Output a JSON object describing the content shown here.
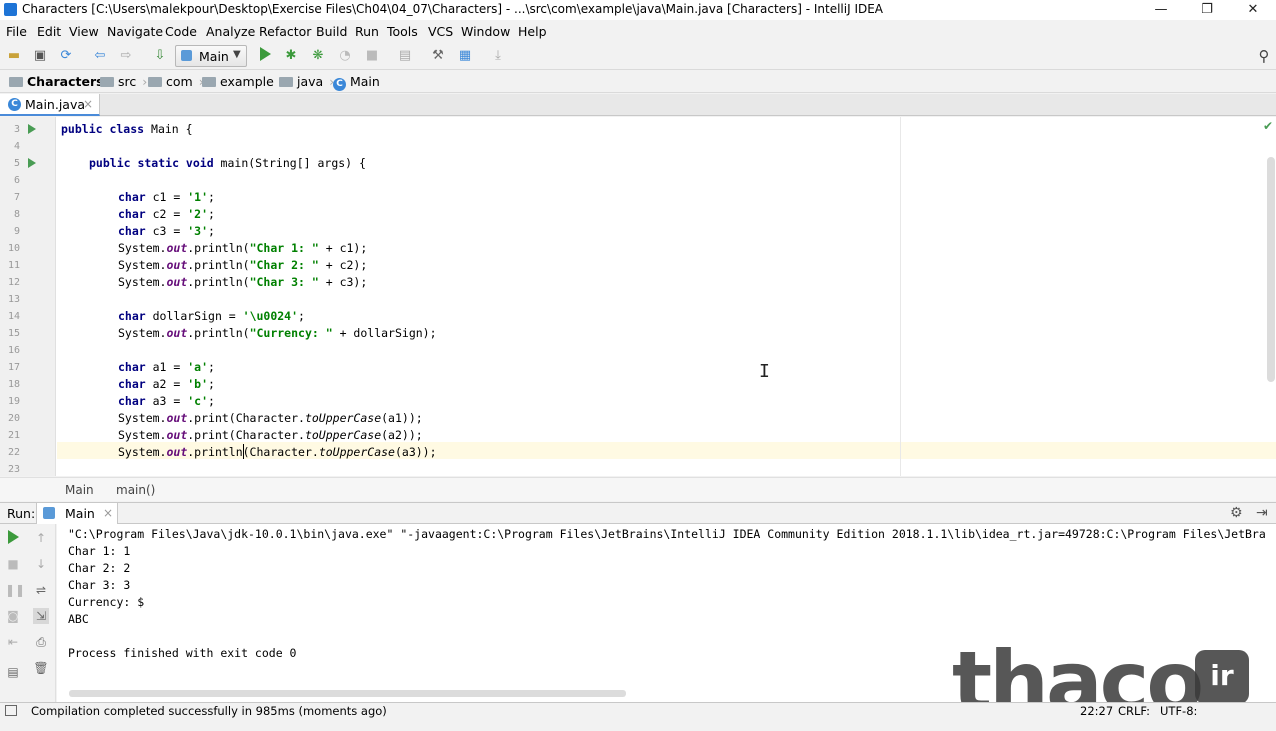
{
  "titlebar": {
    "title": "Characters [C:\\Users\\malekpour\\Desktop\\Exercise Files\\Ch04\\04_07\\Characters] - ...\\src\\com\\example\\java\\Main.java [Characters] - IntelliJ IDEA",
    "minimize": "—",
    "restore": "❐",
    "close": "✕"
  },
  "menubar": [
    "File",
    "Edit",
    "View",
    "Navigate",
    "Code",
    "Analyze",
    "Refactor",
    "Build",
    "Run",
    "Tools",
    "VCS",
    "Window",
    "Help"
  ],
  "toolbar": {
    "run_config": "Main"
  },
  "breadcrumb": [
    "Characters",
    "src",
    "com",
    "example",
    "java",
    "Main"
  ],
  "editor_tab": {
    "label": "Main.java",
    "icon_letter": "C",
    "close": "×"
  },
  "editor": {
    "line_numbers": [
      "3",
      "4",
      "5",
      "6",
      "7",
      "8",
      "9",
      "10",
      "11",
      "12",
      "13",
      "14",
      "15",
      "16",
      "17",
      "18",
      "19",
      "20",
      "21",
      "22",
      "23"
    ],
    "lines": {
      "l3": [
        "public class",
        " Main {"
      ],
      "l5": [
        "public static void",
        " main(String[] args) {"
      ],
      "l7": [
        "char",
        " c1 = ",
        "'1'",
        ";"
      ],
      "l8": [
        "char",
        " c2 = ",
        "'2'",
        ";"
      ],
      "l9": [
        "char",
        " c3 = ",
        "'3'",
        ";"
      ],
      "l10": [
        "System.",
        "out",
        ".println(",
        "\"Char 1: \"",
        " + c1);"
      ],
      "l11": [
        "System.",
        "out",
        ".println(",
        "\"Char 2: \"",
        " + c2);"
      ],
      "l12": [
        "System.",
        "out",
        ".println(",
        "\"Char 3: \"",
        " + c3);"
      ],
      "l14": [
        "char",
        " dollarSign = ",
        "'\\u0024'",
        ";"
      ],
      "l15": [
        "System.",
        "out",
        ".println(",
        "\"Currency: \"",
        " + dollarSign);"
      ],
      "l17": [
        "char",
        " a1 = ",
        "'a'",
        ";"
      ],
      "l18": [
        "char",
        " a2 = ",
        "'b'",
        ";"
      ],
      "l19": [
        "char",
        " a3 = ",
        "'c'",
        ";"
      ],
      "l20": [
        "System.",
        "out",
        ".print(Character.",
        "toUpperCase",
        "(a1));"
      ],
      "l21": [
        "System.",
        "out",
        ".print(Character.",
        "toUpperCase",
        "(a2));"
      ],
      "l22": [
        "System.",
        "out",
        ".println(Character.",
        "toUpperCase",
        "(a3));"
      ]
    }
  },
  "code_breadcrumb": [
    "Main",
    "main()"
  ],
  "run_panel": {
    "label": "Run:",
    "tab": "Main",
    "console": [
      "\"C:\\Program Files\\Java\\jdk-10.0.1\\bin\\java.exe\" \"-javaagent:C:\\Program Files\\JetBrains\\IntelliJ IDEA Community Edition 2018.1.1\\lib\\idea_rt.jar=49728:C:\\Program Files\\JetBra",
      "Char 1: 1",
      "Char 2: 2",
      "Char 3: 3",
      "Currency: $",
      "ABC",
      "",
      "Process finished with exit code 0"
    ]
  },
  "statusbar": {
    "message": "Compilation completed successfully in 985ms (moments ago)",
    "position": "22:27",
    "line_sep": "CRLF:",
    "encoding": "UTF-8:"
  },
  "watermark": {
    "text": "thaco",
    "badge": "ir"
  },
  "colors": {
    "keyword": "#000080",
    "string": "#008000",
    "field": "#660e7a",
    "run_green": "#499c54",
    "accent": "#4a8bd9"
  }
}
